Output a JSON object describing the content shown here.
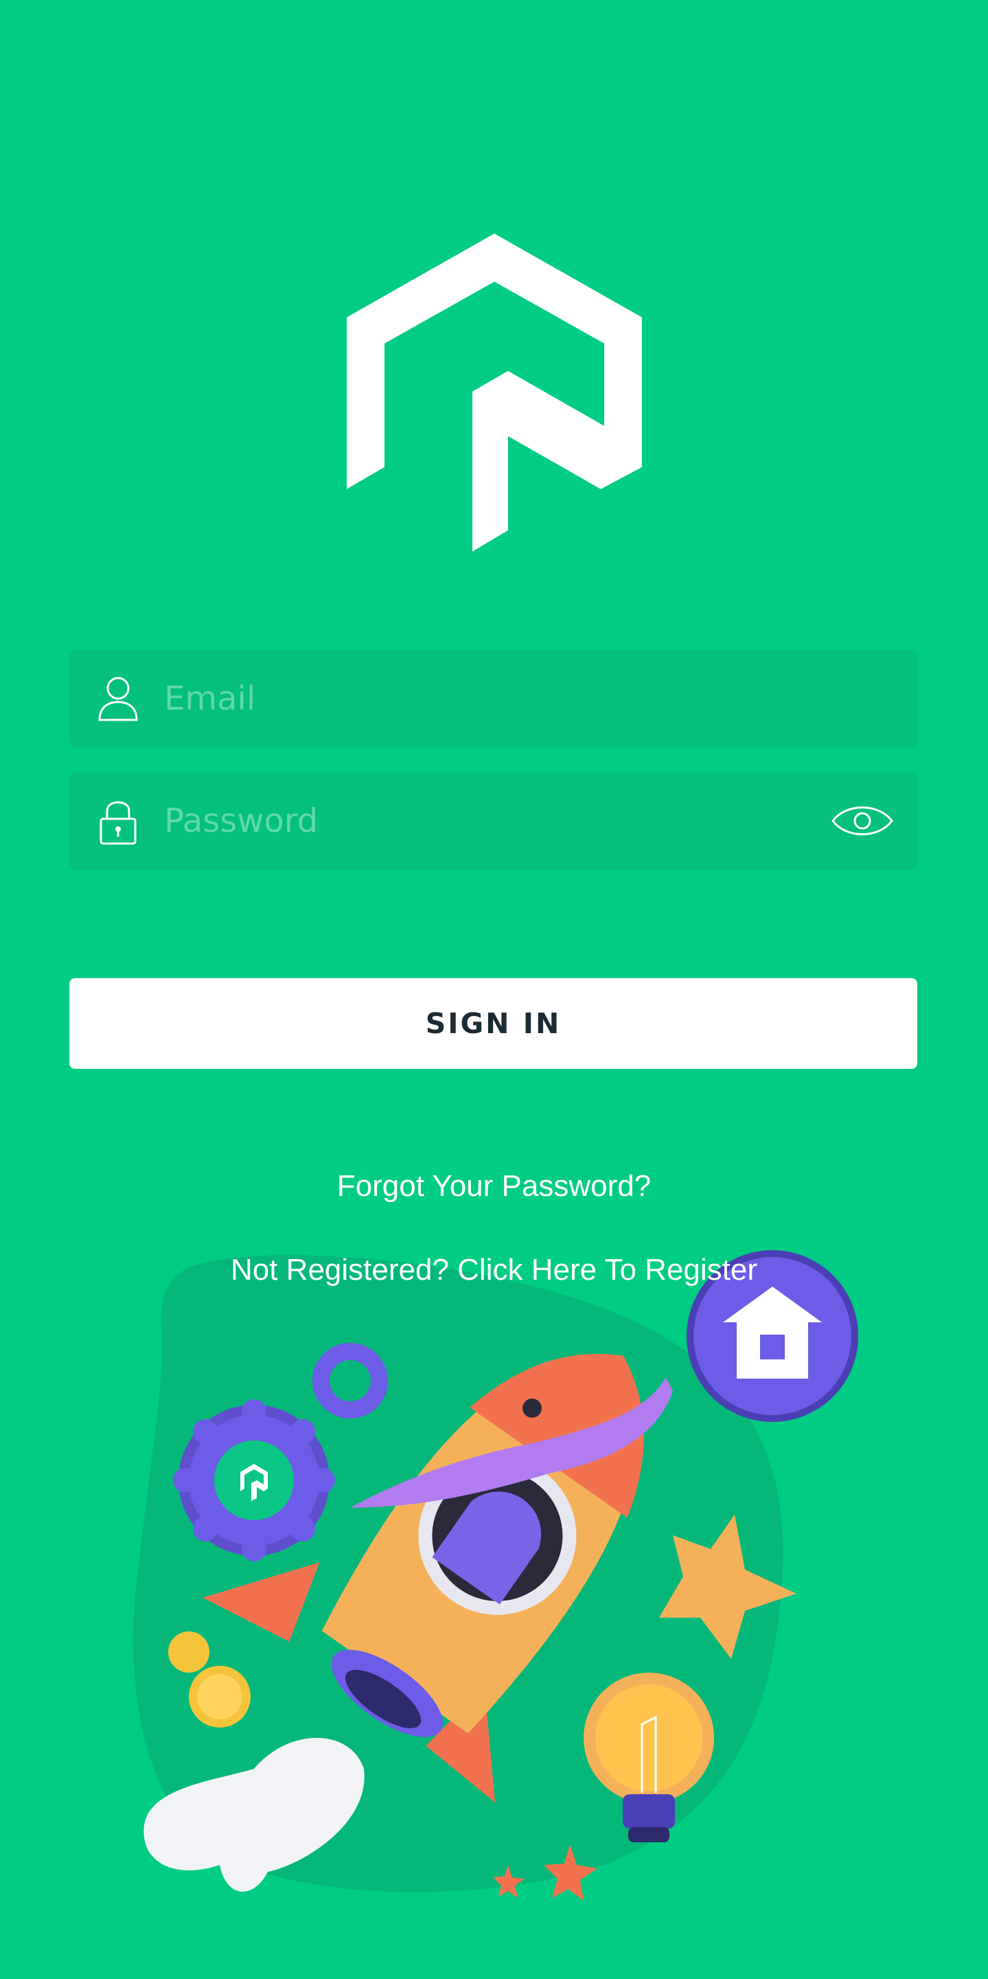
{
  "login": {
    "email_placeholder": "Email",
    "password_placeholder": "Password",
    "signin_label": "SIGN IN",
    "forgot_label": "Forgot Your Password?",
    "register_label": "Not Registered? Click Here To Register"
  },
  "icons": {
    "email": "user-icon",
    "password": "lock-icon",
    "toggle": "eye-icon"
  },
  "colors": {
    "background": "#00CC83",
    "field": "#06C07D",
    "button": "#FFFFFF",
    "button_text": "#1C2A33",
    "accent_purple": "#6C5CE7"
  }
}
